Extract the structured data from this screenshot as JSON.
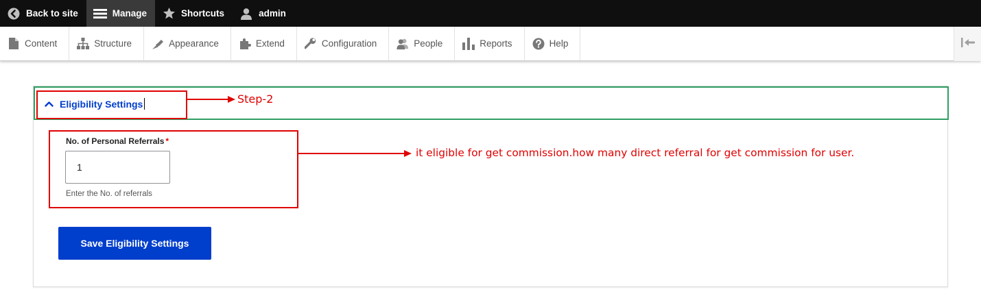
{
  "toolbar": {
    "back_to_site": "Back to site",
    "manage": "Manage",
    "shortcuts": "Shortcuts",
    "user": "admin"
  },
  "tray": {
    "items": [
      {
        "label": "Content",
        "icon": "document-icon"
      },
      {
        "label": "Structure",
        "icon": "sitemap-icon"
      },
      {
        "label": "Appearance",
        "icon": "paintbrush-icon"
      },
      {
        "label": "Extend",
        "icon": "puzzle-icon"
      },
      {
        "label": "Configuration",
        "icon": "wrench-icon"
      },
      {
        "label": "People",
        "icon": "people-icon"
      },
      {
        "label": "Reports",
        "icon": "bar-chart-icon"
      },
      {
        "label": "Help",
        "icon": "help-icon"
      }
    ],
    "toggle_icon": "collapse-icon"
  },
  "section": {
    "title": "Eligibility Settings",
    "field_label": "No. of Personal Referrals",
    "required_mark": "*",
    "field_value": "1",
    "field_description": "Enter the No. of referrals",
    "save_button": "Save Eligibility Settings"
  },
  "annotations": {
    "step": "Step-2",
    "note": "it eligible for get commission.how many direct referral for get commission for user."
  },
  "colors": {
    "accent": "#003ecc",
    "annotation": "#e00000",
    "focus_outline": "#2e9e62"
  }
}
